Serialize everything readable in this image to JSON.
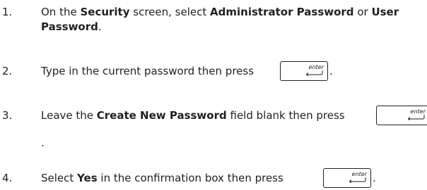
{
  "steps": [
    {
      "number": "1.",
      "line1": {
        "t1": "On the ",
        "b1": "Security",
        "t2": " screen, select ",
        "b2": "Administrator Password",
        "t3": " or ",
        "b3": "User"
      },
      "line2": {
        "b1": "Password",
        "t1": "."
      }
    },
    {
      "number": "2.",
      "text": "Type in the current password then press",
      "key_label": "enter",
      "after": "."
    },
    {
      "number": "3.",
      "t1": "Leave the ",
      "b1": "Create New Password",
      "t2": " field blank then press",
      "key_label": "enter",
      "after": "."
    },
    {
      "number": "4.",
      "t1": "Select ",
      "b1": "Yes",
      "t2": " in the confirmation box then press",
      "key_label": "enter",
      "after": "."
    }
  ]
}
